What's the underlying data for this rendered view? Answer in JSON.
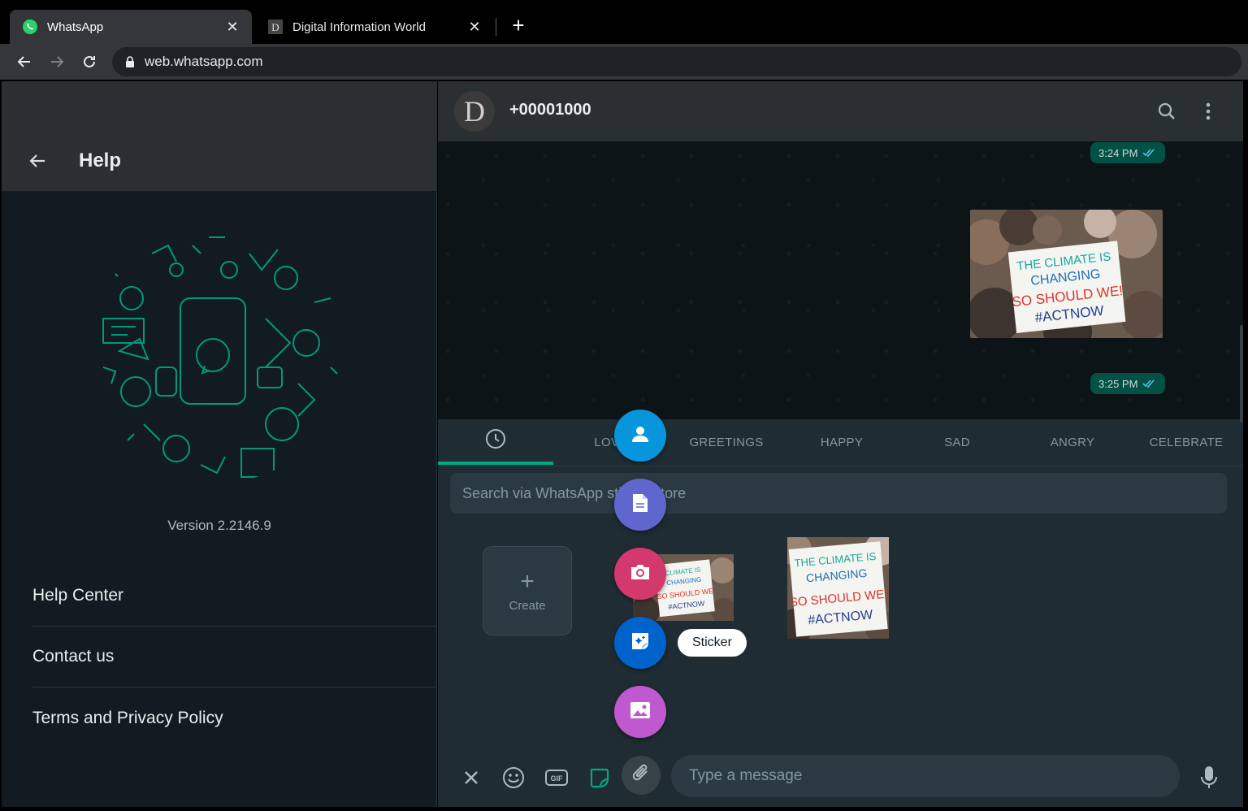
{
  "browser": {
    "tabs": [
      {
        "title": "WhatsApp",
        "active": true
      },
      {
        "title": "Digital Information World",
        "active": false
      }
    ],
    "url": "web.whatsapp.com"
  },
  "help": {
    "title": "Help",
    "version": "Version 2.2146.9",
    "items": [
      "Help Center",
      "Contact us",
      "Terms and Privacy Policy"
    ]
  },
  "chat": {
    "contact_name": "+00001000",
    "avatar_letter": "D",
    "messages": [
      {
        "time": "3:24 PM",
        "status": "read"
      },
      {
        "type": "image",
        "caption_art": [
          "THE CLIMATE IS",
          "CHANGING",
          "SO SHOULD WE!",
          "#ACTNOW"
        ]
      },
      {
        "time": "3:25 PM",
        "status": "read"
      }
    ]
  },
  "stickers": {
    "tabs": [
      "LOVE",
      "GREETINGS",
      "HAPPY",
      "SAD",
      "ANGRY",
      "CELEBRATE"
    ],
    "search_placeholder": "Search via WhatsApp sticker store",
    "create_label": "Create"
  },
  "attach_menu": {
    "items": [
      {
        "icon": "contact-icon",
        "color": "#0795dc"
      },
      {
        "icon": "document-icon",
        "color": "#5f66cd"
      },
      {
        "icon": "camera-icon",
        "color": "#d3396d"
      },
      {
        "icon": "sticker-icon",
        "color": "#0063cb"
      },
      {
        "icon": "gallery-icon",
        "color": "#bf59cf"
      }
    ],
    "tooltip": "Sticker"
  },
  "compose": {
    "placeholder": "Type a message"
  },
  "colors": {
    "accent": "#00a884",
    "outgoing_bubble": "#025144",
    "panel": "#1f2c33"
  }
}
